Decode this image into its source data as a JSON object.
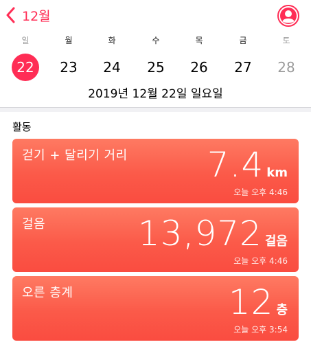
{
  "nav": {
    "back_label": "12월",
    "back_icon": "chevron-left-icon",
    "profile_icon": "person-icon",
    "accent": "#ff2d55"
  },
  "week": {
    "weekdays": [
      "일",
      "월",
      "화",
      "수",
      "목",
      "금",
      "토"
    ],
    "dates": [
      "22",
      "23",
      "24",
      "25",
      "26",
      "27",
      "28"
    ],
    "selected_index": 0
  },
  "full_date": "2019년 12월 22일 일요일",
  "section": {
    "title": "활동"
  },
  "cards": [
    {
      "title": "걷기 + 달리기 거리",
      "value": "7.4",
      "unit": "km",
      "time": "오늘 오후 4:46"
    },
    {
      "title": "걸음",
      "value": "13,972",
      "unit": "걸음",
      "time": "오늘 오후 4:46"
    },
    {
      "title": "오른 층계",
      "value": "12",
      "unit": "층",
      "time": "오늘 오후 3:54"
    }
  ],
  "card_color": "#fb5a49"
}
